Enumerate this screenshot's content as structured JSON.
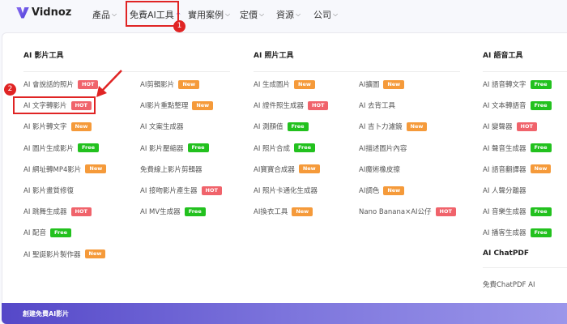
{
  "brand": "Vidnoz",
  "nav": [
    {
      "label": "產品"
    },
    {
      "label": "免費AI工具"
    },
    {
      "label": "實用案例"
    },
    {
      "label": "定價"
    },
    {
      "label": "資源"
    },
    {
      "label": "公司"
    }
  ],
  "badge_colors": {
    "HOT": "#f0636b",
    "New": "#f59a3a",
    "Free": "#22c11e"
  },
  "sections": {
    "video": {
      "title": "AI 影片工具",
      "col1": [
        {
          "label": "AI 會說話的照片",
          "badge": "HOT"
        },
        {
          "label": "AI 文字轉影片",
          "badge": "HOT"
        },
        {
          "label": "AI 影片轉文字",
          "badge": "New"
        },
        {
          "label": "AI 圖片生成影片",
          "badge": "Free"
        },
        {
          "label": "AI 網址轉MP4影片",
          "badge": "New"
        },
        {
          "label": "AI 影片畫質修復",
          "badge": ""
        },
        {
          "label": "AI 跳舞生成器",
          "badge": "HOT"
        },
        {
          "label": "AI 配音",
          "badge": "Free"
        },
        {
          "label": "AI 聖誕影片製作器",
          "badge": "New"
        }
      ],
      "col2": [
        {
          "label": "AI剪輯影片",
          "badge": "New"
        },
        {
          "label": "AI影片重點整理",
          "badge": "New"
        },
        {
          "label": "AI 文案生成器",
          "badge": ""
        },
        {
          "label": "AI 影片壓縮器",
          "badge": "Free"
        },
        {
          "label": "免費線上影片剪輯器",
          "badge": ""
        },
        {
          "label": "AI 接吻影片產生器",
          "badge": "HOT"
        },
        {
          "label": "AI MV生成器",
          "badge": "Free"
        }
      ]
    },
    "photo": {
      "title": "AI 照片工具",
      "col1": [
        {
          "label": "AI 生成圖片",
          "badge": "New"
        },
        {
          "label": "AI 證件照生成器",
          "badge": "HOT"
        },
        {
          "label": "AI 測顏值",
          "badge": "Free"
        },
        {
          "label": "AI 照片合成",
          "badge": "Free"
        },
        {
          "label": "AI寶寶合成器",
          "badge": "New"
        },
        {
          "label": "AI 照片卡通化生成器",
          "badge": ""
        },
        {
          "label": "AI換衣工具",
          "badge": "New"
        }
      ],
      "col2": [
        {
          "label": "AI擴圖",
          "badge": "New"
        },
        {
          "label": "AI 去背工具",
          "badge": ""
        },
        {
          "label": "AI 吉卜力濾鏡",
          "badge": "New"
        },
        {
          "label": "AI描述圖片內容",
          "badge": ""
        },
        {
          "label": "AI魔術橡皮擦",
          "badge": ""
        },
        {
          "label": "AI調色",
          "badge": "New"
        },
        {
          "label": "Nano Banana×AI公仔",
          "badge": "HOT"
        }
      ]
    },
    "audio": {
      "title": "AI 語音工具",
      "col1": [
        {
          "label": "AI 語音轉文字",
          "badge": "Free"
        },
        {
          "label": "AI 文本轉語音",
          "badge": "Free"
        },
        {
          "label": "AI 變聲器",
          "badge": "HOT"
        },
        {
          "label": "AI 聲音生成器",
          "badge": "Free"
        },
        {
          "label": "AI 語音翻譯器",
          "badge": "New"
        },
        {
          "label": "AI 人聲分離器",
          "badge": ""
        },
        {
          "label": "AI 音樂生成器",
          "badge": "Free"
        },
        {
          "label": "AI 播客生成器",
          "badge": "Free"
        }
      ]
    },
    "chatpdf": {
      "title": "AI ChatPDF",
      "items": [
        {
          "label": "免費ChatPDF AI"
        }
      ]
    }
  },
  "footer": {
    "label": "創建免費AI影片"
  },
  "annotations": [
    "1",
    "2"
  ]
}
